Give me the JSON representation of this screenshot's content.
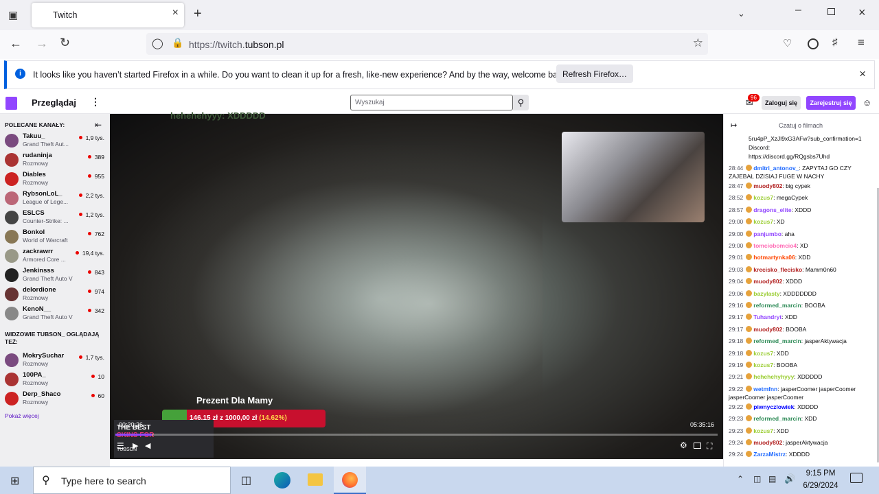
{
  "browser": {
    "tab_title": "Twitch",
    "url_prefix": "https://twitch.",
    "url_domain": "tubson.pl",
    "notification": "It looks like you haven’t started Firefox in a while. Do you want to clean it up for a fresh, like-new experience? And by the way, welcome back!",
    "refresh_button": "Refresh Firefox…"
  },
  "twitch": {
    "browse": "Przeglądaj",
    "search_placeholder": "Wyszukaj",
    "notif_count": "96",
    "login": "Zaloguj się",
    "signup": "Zarejestruj się",
    "recommended_title": "POLECANE KANAŁY:",
    "channels": [
      {
        "name": "Takuu_",
        "game": "Grand Theft Aut...",
        "viewers": "1,9 tys."
      },
      {
        "name": "rudaninja",
        "game": "Rozmowy",
        "viewers": "389"
      },
      {
        "name": "Diables",
        "game": "Rozmowy",
        "viewers": "955"
      },
      {
        "name": "RybsonLoL_",
        "game": "League of Lege...",
        "viewers": "2,2 tys."
      },
      {
        "name": "ESLCS",
        "game": "Counter-Strike: ...",
        "viewers": "1,2 tys."
      },
      {
        "name": "Bonkol",
        "game": "World of Warcraft",
        "viewers": "762"
      },
      {
        "name": "zackrawrr",
        "game": "Armored Core ...",
        "viewers": "19,4 tys."
      },
      {
        "name": "Jenkinsss",
        "game": "Grand Theft Auto V",
        "viewers": "843"
      },
      {
        "name": "delordione",
        "game": "Rozmowy",
        "viewers": "974"
      },
      {
        "name": "KenoN__",
        "game": "Grand Theft Auto V",
        "viewers": "342"
      }
    ],
    "also_title": "WIDZOWIE TUBSON_ OGLĄDAJĄ TEŻ:",
    "also": [
      {
        "name": "MokrySuchar",
        "game": "Rozmowy",
        "viewers": "1,7 tys."
      },
      {
        "name": "100PA_",
        "game": "Rozmowy",
        "viewers": "10"
      },
      {
        "name": "Derp_Shaco",
        "game": "Rozmowy",
        "viewers": "60"
      }
    ],
    "show_more": "Pokaż więcej"
  },
  "video": {
    "top_text": "hehehehyyy: XDDDDD",
    "donation_title": "Prezent Dla Mamy",
    "donation_amount": "146,15 zł",
    "donation_of": "z",
    "donation_goal": "1000,00 zł",
    "donation_pct": "(14.62%)",
    "elapsed": "00:20:26",
    "duration": "05:35:16",
    "ad_line1": "THE BEST",
    "ad_line2": "SKINS FOR",
    "ad_brand": "TUBSON",
    "progress": 0.06
  },
  "chat": {
    "title": "Czatuj o filmach",
    "pre": [
      "5ru4pP_XzJl9xG3AFw?sub_confirmation=1",
      "Discord:",
      "https://discord.gg/RQgsbs7Uhd"
    ],
    "messages": [
      {
        "t": "28:44",
        "u": "dmitri_antonov_",
        "c": "#1e69ff",
        "m": "ZAPYTAJ GO CZY ZAJEBAŁ DZISIAJ FUGE W NACHY"
      },
      {
        "t": "28:47",
        "u": "muody802",
        "c": "#b22222",
        "m": "big cypek"
      },
      {
        "t": "28:52",
        "u": "kozus7",
        "c": "#9acd32",
        "m": "megaCypek"
      },
      {
        "t": "28:57",
        "u": "dragons_elite",
        "c": "#9146ff",
        "m": "XDDD"
      },
      {
        "t": "29:00",
        "u": "kozus7",
        "c": "#9acd32",
        "m": "XD"
      },
      {
        "t": "29:00",
        "u": "panjumbo",
        "c": "#9146ff",
        "m": "aha"
      },
      {
        "t": "29:00",
        "u": "tomciobomcio4",
        "c": "#ff69b4",
        "m": "XD"
      },
      {
        "t": "29:01",
        "u": "hotmartynka06",
        "c": "#ff4500",
        "m": "XDD"
      },
      {
        "t": "29:03",
        "u": "krecisko_flecisko",
        "c": "#b22222",
        "m": "Mamm0n60"
      },
      {
        "t": "29:04",
        "u": "muody802",
        "c": "#b22222",
        "m": "XDDD"
      },
      {
        "t": "29:06",
        "u": "bazylasty",
        "c": "#9acd32",
        "m": "XDDDDDDD"
      },
      {
        "t": "29:16",
        "u": "reformed_marcin",
        "c": "#2e8b57",
        "m": "BOOBA"
      },
      {
        "t": "29:17",
        "u": "Tuhandryt",
        "c": "#9146ff",
        "m": "XDD"
      },
      {
        "t": "29:17",
        "u": "muody802",
        "c": "#b22222",
        "m": "BOOBA"
      },
      {
        "t": "29:18",
        "u": "reformed_marcin",
        "c": "#2e8b57",
        "m": "jasperAktywacja"
      },
      {
        "t": "29:18",
        "u": "kozus7",
        "c": "#9acd32",
        "m": "XDD"
      },
      {
        "t": "29:19",
        "u": "kozus7",
        "c": "#9acd32",
        "m": "BOOBA"
      },
      {
        "t": "29:21",
        "u": "hehehehyhyyy",
        "c": "#9acd32",
        "m": "XDDDDD"
      },
      {
        "t": "29:22",
        "u": "wetmfnn",
        "c": "#1e69ff",
        "m": "jasperCoomer jasperCoomer jasperCoomer jasperCoomer"
      },
      {
        "t": "29:22",
        "u": "piwnyczlowiek",
        "c": "#0000ff",
        "m": "XDDDD"
      },
      {
        "t": "29:23",
        "u": "reformed_marcin",
        "c": "#2e8b57",
        "m": "XDD"
      },
      {
        "t": "29:23",
        "u": "kozus7",
        "c": "#9acd32",
        "m": "XDD"
      },
      {
        "t": "29:24",
        "u": "muody802",
        "c": "#b22222",
        "m": "jasperAktywacja"
      },
      {
        "t": "29:24",
        "u": "ZarzaMistrz",
        "c": "#1e69ff",
        "m": "XDDDD"
      }
    ]
  },
  "taskbar": {
    "search_placeholder": "Type here to search",
    "time": "9:15 PM",
    "date": "6/29/2024"
  }
}
